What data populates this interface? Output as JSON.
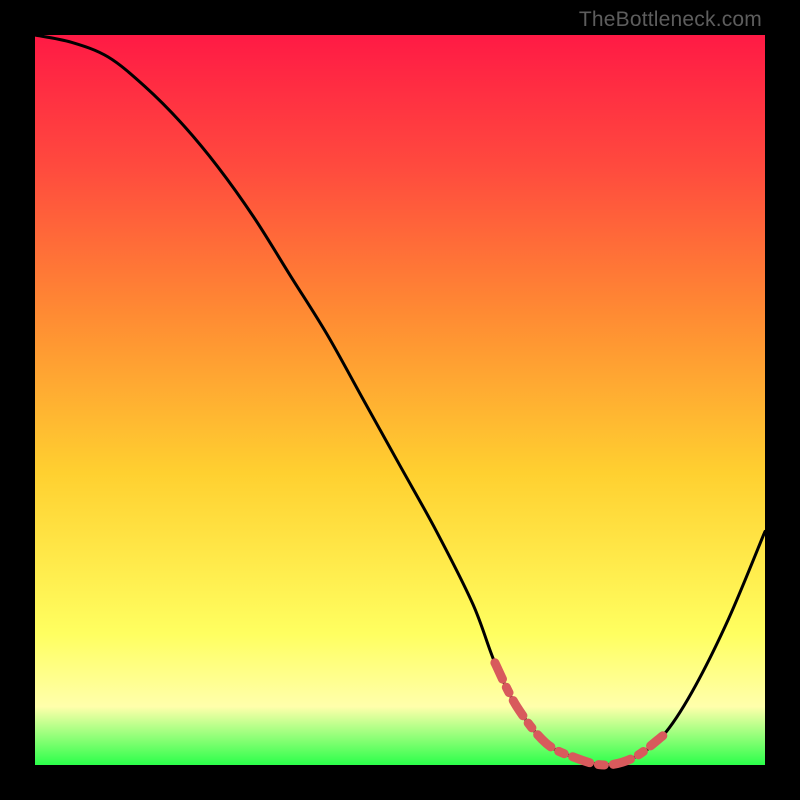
{
  "attribution": "TheBottleneck.com",
  "colors": {
    "background": "#000000",
    "curve_stroke": "#000000",
    "highlight_stroke": "#d85a5c"
  },
  "chart_data": {
    "type": "line",
    "title": "",
    "xlabel": "",
    "ylabel": "",
    "xlim": [
      0,
      100
    ],
    "ylim": [
      0,
      100
    ],
    "series": [
      {
        "name": "bottleneck-curve",
        "x": [
          0,
          5,
          10,
          15,
          20,
          25,
          30,
          35,
          40,
          45,
          50,
          55,
          60,
          63,
          66,
          70,
          74,
          78,
          82,
          86,
          90,
          95,
          100
        ],
        "values": [
          100,
          99,
          97,
          93,
          88,
          82,
          75,
          67,
          59,
          50,
          41,
          32,
          22,
          14,
          8,
          3,
          1,
          0,
          1,
          4,
          10,
          20,
          32
        ]
      }
    ],
    "annotations": [
      {
        "name": "trough-highlight",
        "x_range": [
          63,
          88
        ],
        "note": "dotted/dashed red overlay along curve bottom"
      }
    ]
  }
}
